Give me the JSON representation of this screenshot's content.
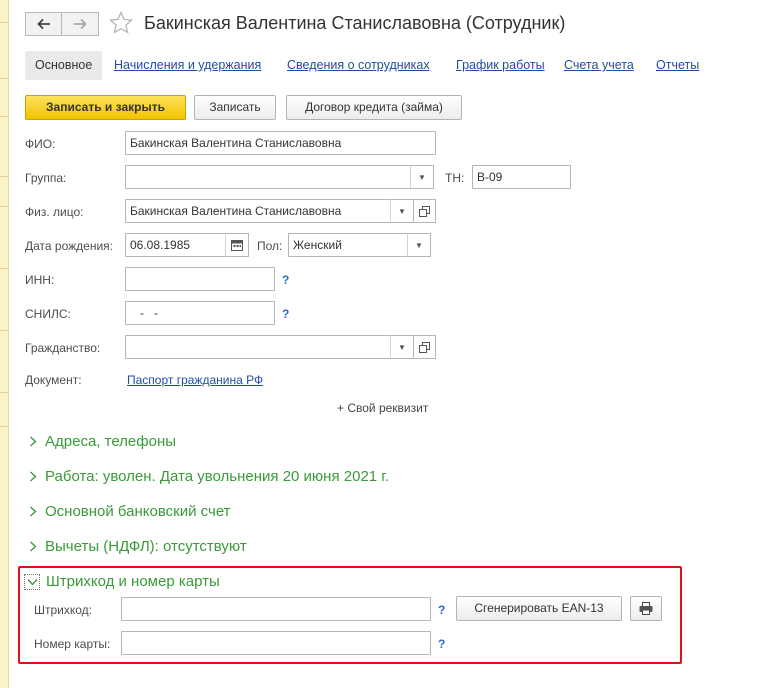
{
  "window": {
    "title": "Бакинская Валентина Станиславовна (Сотрудник)"
  },
  "icons": {
    "back": "arrow-left-icon",
    "forward": "arrow-right-icon",
    "favorite": "star-icon",
    "calendar": "calendar-icon",
    "open": "open-window-icon",
    "printer": "printer-icon",
    "dropdown": "chevron-down-icon",
    "expand": "chevron-right-icon"
  },
  "tabs": {
    "active": "Основное",
    "links": [
      "Начисления и удержания",
      "Сведения о сотрудниках",
      "График работы",
      "Счета учета",
      "Отчеты"
    ]
  },
  "toolbar": {
    "save_close": "Записать и закрыть",
    "save": "Записать",
    "loan": "Договор кредита (займа)"
  },
  "form": {
    "fio_label": "ФИО:",
    "fio_value": "Бакинская Валентина Станиславовна",
    "group_label": "Группа:",
    "group_value": "",
    "tn_label": "ТН:",
    "tn_value": "В-09",
    "person_label": "Физ. лицо:",
    "person_value": "Бакинская Валентина Станиславовна",
    "birth_label": "Дата рождения:",
    "birth_value": "06.08.1985",
    "sex_label": "Пол:",
    "sex_value": "Женский",
    "inn_label": "ИНН:",
    "inn_value": "",
    "snils_label": "СНИЛС:",
    "snils_value": "   -   -",
    "citizenship_label": "Гражданство:",
    "citizenship_value": "",
    "document_label": "Документ:",
    "document_link": "Паспорт гражданина РФ",
    "custom_prop": "+ Свой реквизит",
    "help": "?"
  },
  "groups": {
    "addresses": "Адреса, телефоны",
    "work": "Работа: уволен. Дата увольнения 20 июня 2021 г.",
    "bank": "Основной банковский счет",
    "deductions": "Вычеты (НДФЛ): отсутствуют",
    "barcode": "Штрихкод и номер карты"
  },
  "barcode": {
    "barcode_label": "Штрихкод:",
    "barcode_value": "",
    "card_label": "Номер карты:",
    "card_value": "",
    "generate": "Сгенерировать EAN-13"
  },
  "colors": {
    "accent_yellow": "#f2c200",
    "group_green": "#3a9a3a",
    "link_blue": "#1f4ea7",
    "highlight_red": "#e3101a"
  }
}
